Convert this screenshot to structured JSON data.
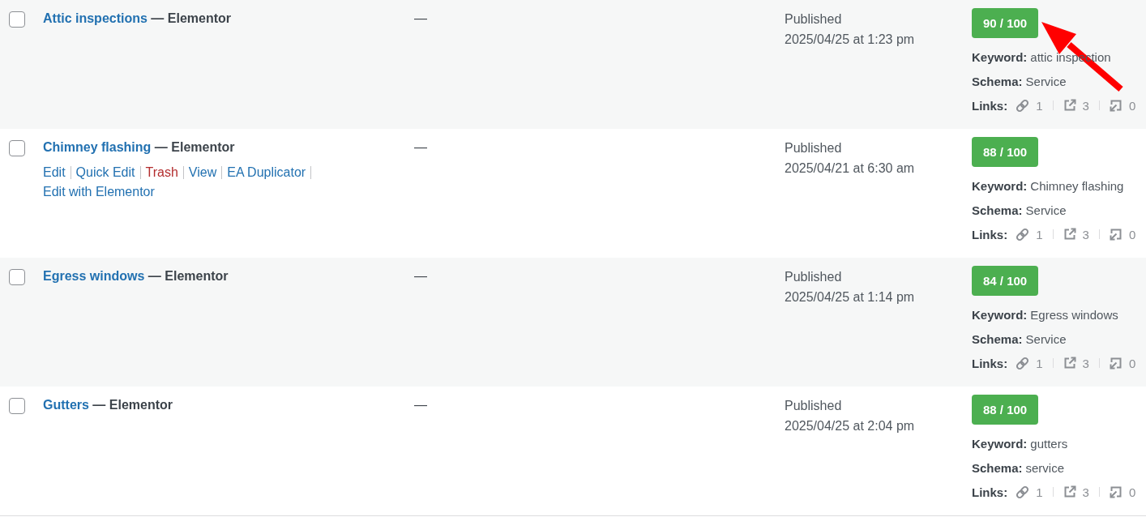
{
  "rows": [
    {
      "checked": false,
      "title": "Attic inspections",
      "post_state": "— Elementor",
      "author": "—",
      "status": "Published",
      "date": "2025/04/25 at 1:23 pm",
      "seo": {
        "score": "90 / 100",
        "keyword_label": "Keyword:",
        "keyword": "attic inspection",
        "schema_label": "Schema:",
        "schema": "Service",
        "links_label": "Links:",
        "internal_links": "1",
        "external_links": "3",
        "incoming_links": "0"
      }
    },
    {
      "checked": false,
      "title": "Chimney flashing",
      "post_state": "— Elementor",
      "actions": [
        {
          "label": "Edit",
          "kind": "link"
        },
        {
          "label": "Quick Edit",
          "kind": "link"
        },
        {
          "label": "Trash",
          "kind": "delete"
        },
        {
          "label": "View",
          "kind": "link"
        },
        {
          "label": "EA Duplicator",
          "kind": "link"
        },
        {
          "label": "Edit with Elementor",
          "kind": "link"
        }
      ],
      "author": "—",
      "status": "Published",
      "date": "2025/04/21 at 6:30 am",
      "seo": {
        "score": "88 / 100",
        "keyword_label": "Keyword:",
        "keyword": "Chimney flashing",
        "schema_label": "Schema:",
        "schema": "Service",
        "links_label": "Links:",
        "internal_links": "1",
        "external_links": "3",
        "incoming_links": "0"
      }
    },
    {
      "checked": false,
      "title": "Egress windows",
      "post_state": "— Elementor",
      "author": "—",
      "status": "Published",
      "date": "2025/04/25 at 1:14 pm",
      "seo": {
        "score": "84 / 100",
        "keyword_label": "Keyword:",
        "keyword": "Egress windows",
        "schema_label": "Schema:",
        "schema": "Service",
        "links_label": "Links:",
        "internal_links": "1",
        "external_links": "3",
        "incoming_links": "0"
      }
    },
    {
      "checked": false,
      "title": "Gutters",
      "post_state": "— Elementor",
      "author": "—",
      "status": "Published",
      "date": "2025/04/25 at 2:04 pm",
      "seo": {
        "score": "88 / 100",
        "keyword_label": "Keyword:",
        "keyword": "gutters",
        "schema_label": "Schema:",
        "schema": "service",
        "links_label": "Links:",
        "internal_links": "1",
        "external_links": "3",
        "incoming_links": "0"
      }
    }
  ],
  "annotations": [
    {
      "kind": "arrow"
    }
  ]
}
